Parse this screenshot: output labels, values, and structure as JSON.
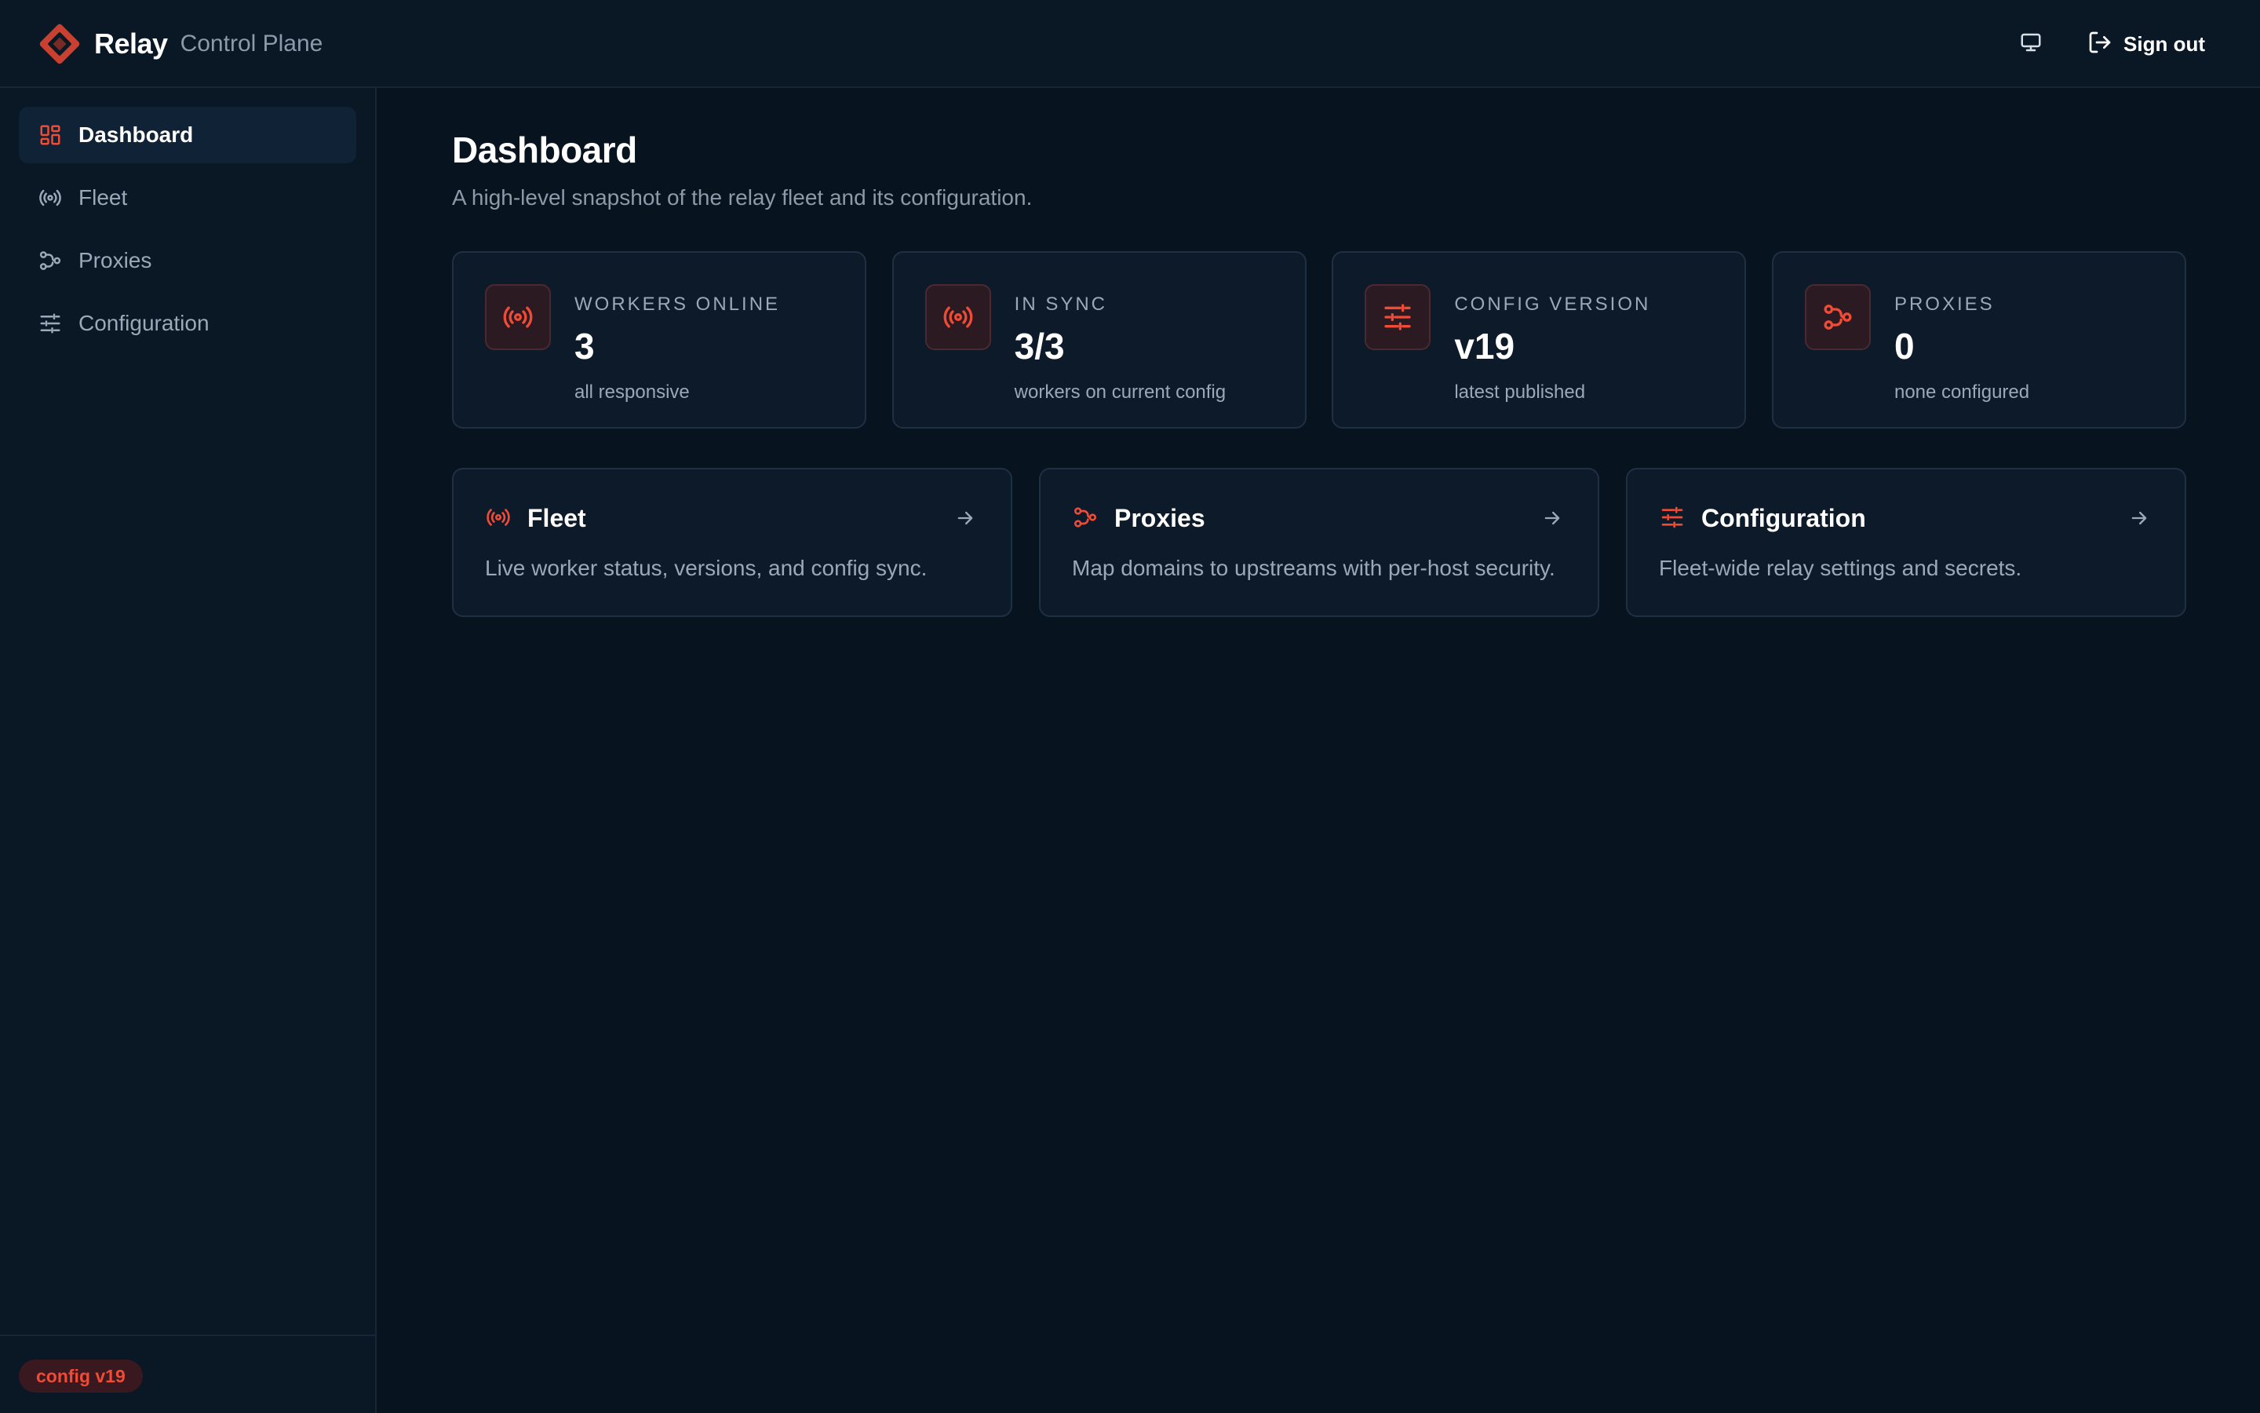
{
  "header": {
    "brand_name": "Relay",
    "brand_sub": "Control Plane",
    "signout_label": "Sign out",
    "icons": {
      "logo": "relay-diamond-logo",
      "display": "monitor-icon",
      "signout": "log-out-icon"
    }
  },
  "sidebar": {
    "items": [
      {
        "label": "Dashboard",
        "icon": "dashboard-grid-icon",
        "active": true
      },
      {
        "label": "Fleet",
        "icon": "broadcast-icon",
        "active": false
      },
      {
        "label": "Proxies",
        "icon": "share-nodes-icon",
        "active": false
      },
      {
        "label": "Configuration",
        "icon": "sliders-icon",
        "active": false
      }
    ],
    "version_badge": "config v19"
  },
  "main": {
    "title": "Dashboard",
    "subtitle": "A high-level snapshot of the relay fleet and its configuration.",
    "stats": [
      {
        "label": "Workers online",
        "value": "3",
        "note": "all responsive",
        "icon": "broadcast-icon"
      },
      {
        "label": "In sync",
        "value": "3/3",
        "note": "workers on current config",
        "icon": "broadcast-icon"
      },
      {
        "label": "Config version",
        "value": "v19",
        "note": "latest published",
        "icon": "sliders-icon"
      },
      {
        "label": "Proxies",
        "value": "0",
        "note": "none configured",
        "icon": "share-nodes-icon"
      }
    ],
    "links": [
      {
        "title": "Fleet",
        "desc": "Live worker status, versions, and config sync.",
        "icon": "broadcast-icon"
      },
      {
        "title": "Proxies",
        "desc": "Map domains to upstreams with per-host security.",
        "icon": "share-nodes-icon"
      },
      {
        "title": "Configuration",
        "desc": "Fleet-wide relay settings and secrets.",
        "icon": "sliders-icon"
      }
    ]
  },
  "colors": {
    "accent": "#ef4b35",
    "background": "#07131f",
    "surface": "#0c1a29",
    "text_muted": "#9aa8b8"
  }
}
